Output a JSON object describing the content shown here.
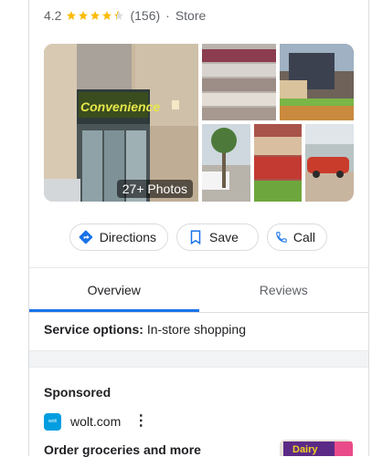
{
  "rating": {
    "value": "4.2",
    "stars_filled": 4.2,
    "reviews": "(156)",
    "separator": "·",
    "category": "Store"
  },
  "photos": {
    "badge": "27+ Photos",
    "main_sign": "Convenience"
  },
  "actions": {
    "directions": "Directions",
    "save": "Save",
    "call": "Call"
  },
  "tabs": [
    {
      "label": "Overview",
      "active": true
    },
    {
      "label": "Reviews",
      "active": false
    }
  ],
  "service": {
    "label": "Service options:",
    "value": "In-store shopping"
  },
  "ad": {
    "sponsored": "Sponsored",
    "logo_text": "wolt",
    "domain": "wolt.com",
    "menu": "⋮",
    "title": "Order groceries and more",
    "thumb_text": "Dairy"
  },
  "colors": {
    "accent": "#1a73e8",
    "star": "#fbbc04",
    "wolt": "#009de0"
  }
}
